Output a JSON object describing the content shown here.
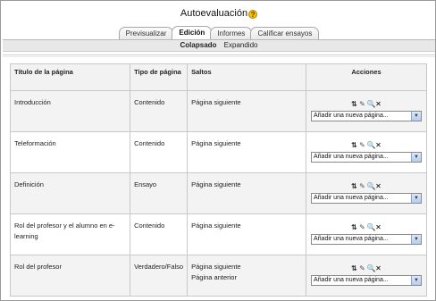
{
  "header": {
    "title": "Autoevaluación",
    "help_icon": "help-icon"
  },
  "tabs": [
    {
      "label": "Previsualizar"
    },
    {
      "label": "Edición"
    },
    {
      "label": "Informes"
    },
    {
      "label": "Calificar ensayos"
    }
  ],
  "subtabs": {
    "collapsed": "Colapsado",
    "expanded": "Expandido"
  },
  "table": {
    "headers": [
      "Título de la página",
      "Tipo de página",
      "Saltos",
      "Acciones"
    ],
    "rows": [
      {
        "title": "Introducción",
        "type": "Contenido",
        "jumps": [
          "Página siguiente"
        ],
        "select_value": "Añadir una nueva página..."
      },
      {
        "title": "Teleformación",
        "type": "Contenido",
        "jumps": [
          "Página siguiente"
        ],
        "select_value": "Añadir una nueva página..."
      },
      {
        "title": "Definición",
        "type": "Ensayo",
        "jumps": [
          "Página siguiente"
        ],
        "select_value": "Añadir una nueva página..."
      },
      {
        "title": "Rol del profesor y el alumno en e-learning",
        "type": "Contenido",
        "jumps": [
          "Página siguiente"
        ],
        "select_value": "Añadir una nueva página..."
      },
      {
        "title": "Rol del profesor",
        "type": "Verdadero/Falso",
        "jumps": [
          "Página siguiente",
          "Página anterior"
        ],
        "select_value": "Añadir una nueva página..."
      }
    ]
  },
  "action_icons": [
    "move-icon",
    "edit-icon",
    "preview-icon",
    "delete-icon"
  ],
  "colors": {
    "help": "#f2c200",
    "row_alt": "#f3f3f3",
    "border": "#c8c8c8"
  }
}
